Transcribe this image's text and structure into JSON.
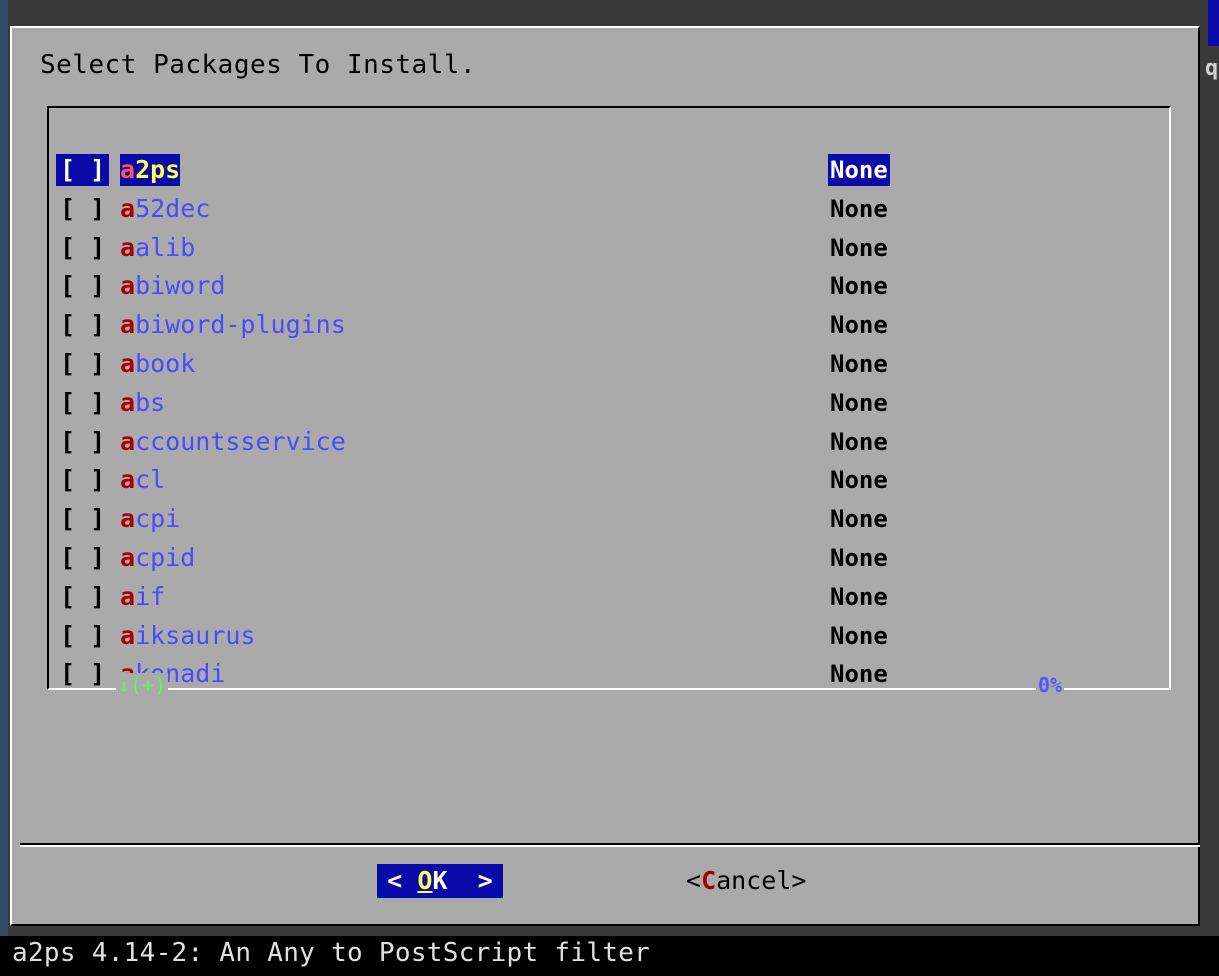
{
  "dialog": {
    "title": "Select Packages To Install."
  },
  "packages": [
    {
      "check": "[ ]",
      "hot": "a",
      "rest": "2ps",
      "status": "None",
      "selected": true
    },
    {
      "check": "[ ]",
      "hot": "a",
      "rest": "52dec",
      "status": "None",
      "selected": false
    },
    {
      "check": "[ ]",
      "hot": "a",
      "rest": "alib",
      "status": "None",
      "selected": false
    },
    {
      "check": "[ ]",
      "hot": "a",
      "rest": "biword",
      "status": "None",
      "selected": false
    },
    {
      "check": "[ ]",
      "hot": "a",
      "rest": "biword-plugins",
      "status": "None",
      "selected": false
    },
    {
      "check": "[ ]",
      "hot": "a",
      "rest": "book",
      "status": "None",
      "selected": false
    },
    {
      "check": "[ ]",
      "hot": "a",
      "rest": "bs",
      "status": "None",
      "selected": false
    },
    {
      "check": "[ ]",
      "hot": "a",
      "rest": "ccountsservice",
      "status": "None",
      "selected": false
    },
    {
      "check": "[ ]",
      "hot": "a",
      "rest": "cl",
      "status": "None",
      "selected": false
    },
    {
      "check": "[ ]",
      "hot": "a",
      "rest": "cpi",
      "status": "None",
      "selected": false
    },
    {
      "check": "[ ]",
      "hot": "a",
      "rest": "cpid",
      "status": "None",
      "selected": false
    },
    {
      "check": "[ ]",
      "hot": "a",
      "rest": "if",
      "status": "None",
      "selected": false
    },
    {
      "check": "[ ]",
      "hot": "a",
      "rest": "iksaurus",
      "status": "None",
      "selected": false
    },
    {
      "check": "[ ]",
      "hot": "a",
      "rest": "konadi",
      "status": "None",
      "selected": false
    }
  ],
  "scroll": {
    "indicator": "↓(+)",
    "percent": "0%"
  },
  "buttons": {
    "ok_left": "< ",
    "ok_hot": "O",
    "ok_rest": "K",
    "ok_right": "  >",
    "cancel_left": "<",
    "cancel_hot": "C",
    "cancel_rest": "ancel",
    "cancel_right": ">"
  },
  "background": {
    "edge_char": "q"
  },
  "status_bar": {
    "text": "a2ps 4.14-2: An Any to PostScript filter"
  },
  "colors": {
    "dialog_bg": "#aaaaaa",
    "selection_bg": "#0a0aa8",
    "hotkey": "#a80000",
    "item_text": "#4a4aff",
    "scroll_indicator": "#55ff55"
  }
}
